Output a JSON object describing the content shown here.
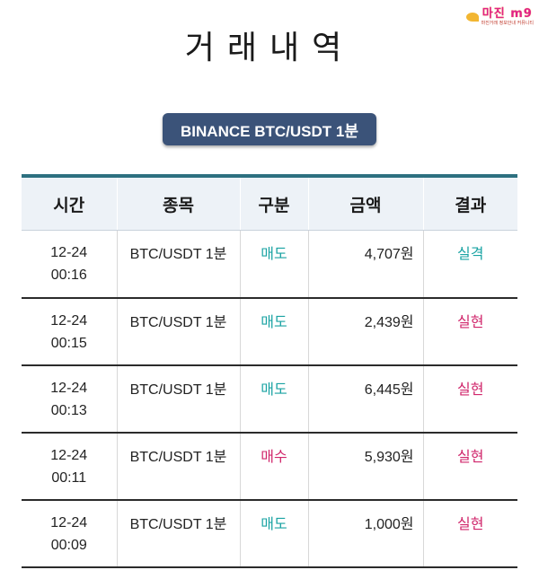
{
  "logo": {
    "main": "마진 m9",
    "sub": "마진거래 정보안내 커뮤니티"
  },
  "page_title": "거래내역",
  "market_label": "BINANCE BTC/USDT 1분",
  "table": {
    "headers": [
      "시간",
      "종목",
      "구분",
      "금액",
      "결과"
    ],
    "rows": [
      {
        "date": "12-24",
        "time": "00:16",
        "symbol": "BTC/USDT 1분",
        "side": "매도",
        "side_type": "sell",
        "amount": "4,707원",
        "result": "실격",
        "result_type": "fail"
      },
      {
        "date": "12-24",
        "time": "00:15",
        "symbol": "BTC/USDT 1분",
        "side": "매도",
        "side_type": "sell",
        "amount": "2,439원",
        "result": "실현",
        "result_type": "win"
      },
      {
        "date": "12-24",
        "time": "00:13",
        "symbol": "BTC/USDT 1분",
        "side": "매도",
        "side_type": "sell",
        "amount": "6,445원",
        "result": "실현",
        "result_type": "win"
      },
      {
        "date": "12-24",
        "time": "00:11",
        "symbol": "BTC/USDT 1분",
        "side": "매수",
        "side_type": "buy",
        "amount": "5,930원",
        "result": "실현",
        "result_type": "win"
      },
      {
        "date": "12-24",
        "time": "00:09",
        "symbol": "BTC/USDT 1분",
        "side": "매도",
        "side_type": "sell",
        "amount": "1,000원",
        "result": "실현",
        "result_type": "win"
      }
    ]
  },
  "colors": {
    "header_bar": "#2d7080",
    "badge_bg": "#3b5379",
    "sell": "#1aa3a3",
    "buy": "#d0266b"
  }
}
